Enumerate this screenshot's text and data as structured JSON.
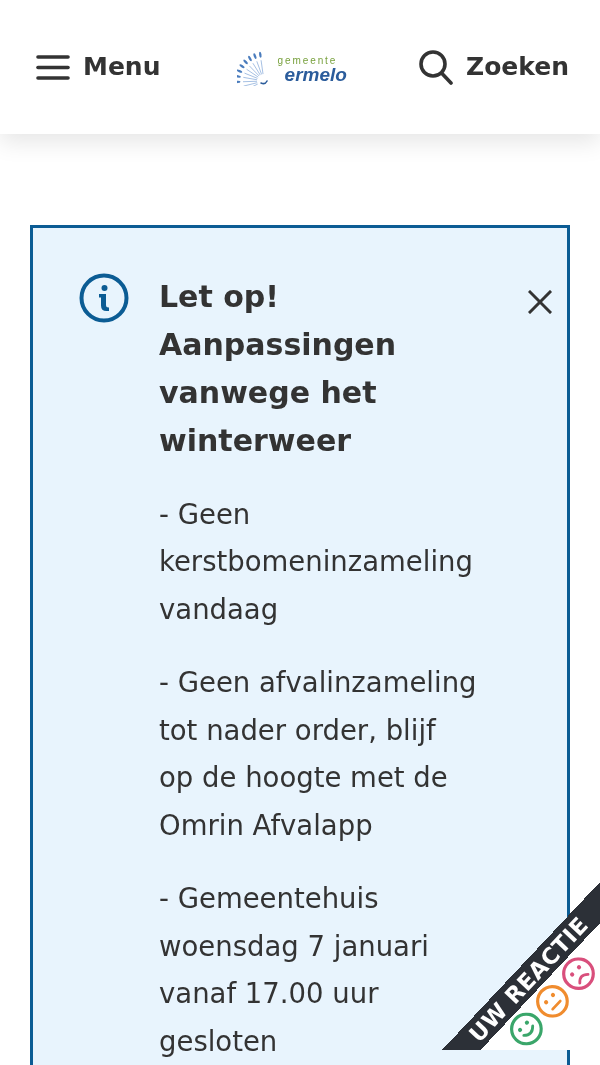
{
  "header": {
    "menu_button": {
      "label": "Menu"
    },
    "logo": {
      "subtitle": "gemeente",
      "name": "ermelo"
    },
    "search_button": {
      "label": "Zoeken"
    }
  },
  "alert": {
    "title": "Let op! Aanpassingen vanwege het winterweer",
    "paragraphs": [
      "- Geen kerstbomeninzameling vandaag",
      "- Geen afvalinzameling tot nader order, blijf op de hoogte met de Omrin Afvalapp",
      "- Gemeentehuis woensdag 7 januari vanaf 17.00 uur gesloten"
    ]
  },
  "feedback_tab": {
    "label": "UW REACTIE",
    "faces": [
      {
        "kind": "happy",
        "color": "#3aa66a"
      },
      {
        "kind": "neutral",
        "color": "#f08c2e"
      },
      {
        "kind": "sad",
        "color": "#d94f7c"
      }
    ]
  }
}
